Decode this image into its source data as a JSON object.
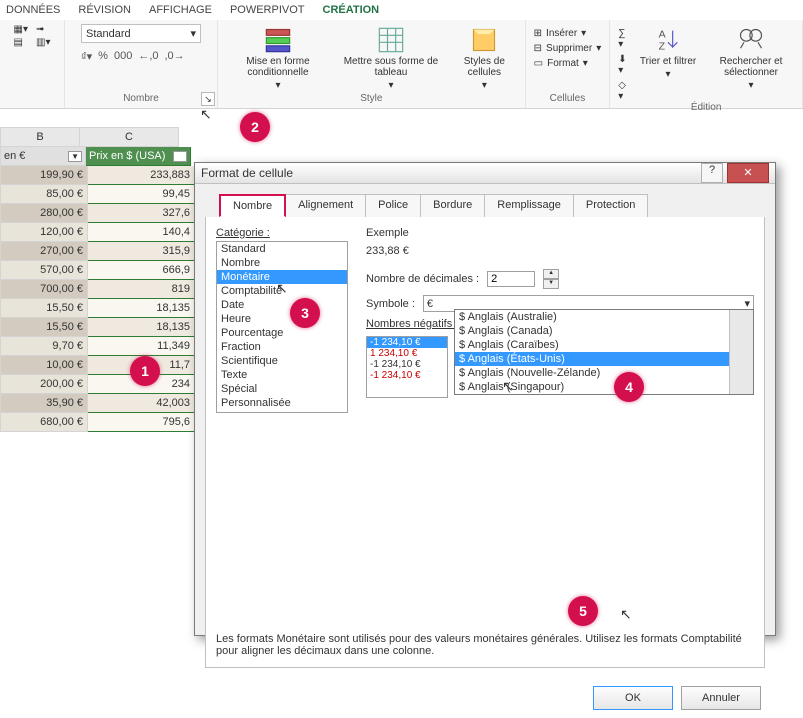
{
  "ribbonTabs": {
    "t0": "DONNÉES",
    "t1": "RÉVISION",
    "t2": "AFFICHAGE",
    "t3": "POWERPIVOT",
    "t4": "CRÉATION"
  },
  "number": {
    "group": "Nombre",
    "format": "Standard",
    "b0": "%",
    "b1": "000",
    "b2": "←,0",
    "b3": ",0→"
  },
  "style": {
    "group": "Style",
    "cond": "Mise en forme conditionnelle",
    "table": "Mettre sous forme de tableau",
    "cell": "Styles de cellules"
  },
  "cells": {
    "group": "Cellules",
    "ins": "Insérer",
    "del": "Supprimer",
    "fmt": "Format"
  },
  "edit": {
    "group": "Édition",
    "sort": "Trier et filtrer",
    "find": "Rechercher et sélectionner"
  },
  "cols": {
    "B": "B",
    "C": "C"
  },
  "head": {
    "B": "en €",
    "C": "Prix en $ (USA)",
    "drop": "▼"
  },
  "rows": {
    "r0b": "199,90 €",
    "r0c": "233,883",
    "r1b": "85,00 €",
    "r1c": "99,45",
    "r2b": "280,00 €",
    "r2c": "327,6",
    "r3b": "120,00 €",
    "r3c": "140,4",
    "r4b": "270,00 €",
    "r4c": "315,9",
    "r5b": "570,00 €",
    "r5c": "666,9",
    "r6b": "700,00 €",
    "r6c": "819",
    "r7b": "15,50 €",
    "r7c": "18,135",
    "r8b": "15,50 €",
    "r8c": "18,135",
    "r9b": "9,70 €",
    "r9c": "11,349",
    "r10b": "10,00 €",
    "r10c": "11,7",
    "r11b": "200,00 €",
    "r11c": "234",
    "r12b": "35,90 €",
    "r12c": "42,003",
    "r13b": "680,00 €",
    "r13c": "795,6"
  },
  "dlg": {
    "title": "Format de cellule",
    "help": "?",
    "close": "✕",
    "tabs": {
      "t0": "Nombre",
      "t1": "Alignement",
      "t2": "Police",
      "t3": "Bordure",
      "t4": "Remplissage",
      "t5": "Protection"
    },
    "catLbl": "Catégorie :",
    "cats": {
      "c0": "Standard",
      "c1": "Nombre",
      "c2": "Monétaire",
      "c3": "Comptabilité",
      "c4": "Date",
      "c5": "Heure",
      "c6": "Pourcentage",
      "c7": "Fraction",
      "c8": "Scientifique",
      "c9": "Texte",
      "c10": "Spécial",
      "c11": "Personnalisée"
    },
    "exLbl": "Exemple",
    "exVal": "233,88 €",
    "decLbl": "Nombre de décimales :",
    "decVal": "2",
    "symLbl": "Symbole :",
    "symVal": "€",
    "symDrop": "▾",
    "negLbl": "Nombres négatifs :",
    "neg": {
      "n0": "-1 234,10 €",
      "n1": "1 234,10 €",
      "n2": "-1 234,10 €",
      "n3": "-1 234,10 €"
    },
    "opts": {
      "o0": "$ Anglais (Australie)",
      "o1": "$ Anglais (Canada)",
      "o2": "$ Anglais (Caraïbes)",
      "o3": "$ Anglais (États-Unis)",
      "o4": "$ Anglais (Nouvelle-Zélande)",
      "o5": "$ Anglais (Singapour)"
    },
    "desc": "Les formats Monétaire sont utilisés pour des valeurs monétaires générales. Utilisez les formats Comptabilité pour aligner les décimaux dans une colonne.",
    "ok": "OK",
    "cancel": "Annuler"
  },
  "ann": {
    "a1": "1",
    "a2": "2",
    "a3": "3",
    "a4": "4",
    "a5": "5"
  }
}
